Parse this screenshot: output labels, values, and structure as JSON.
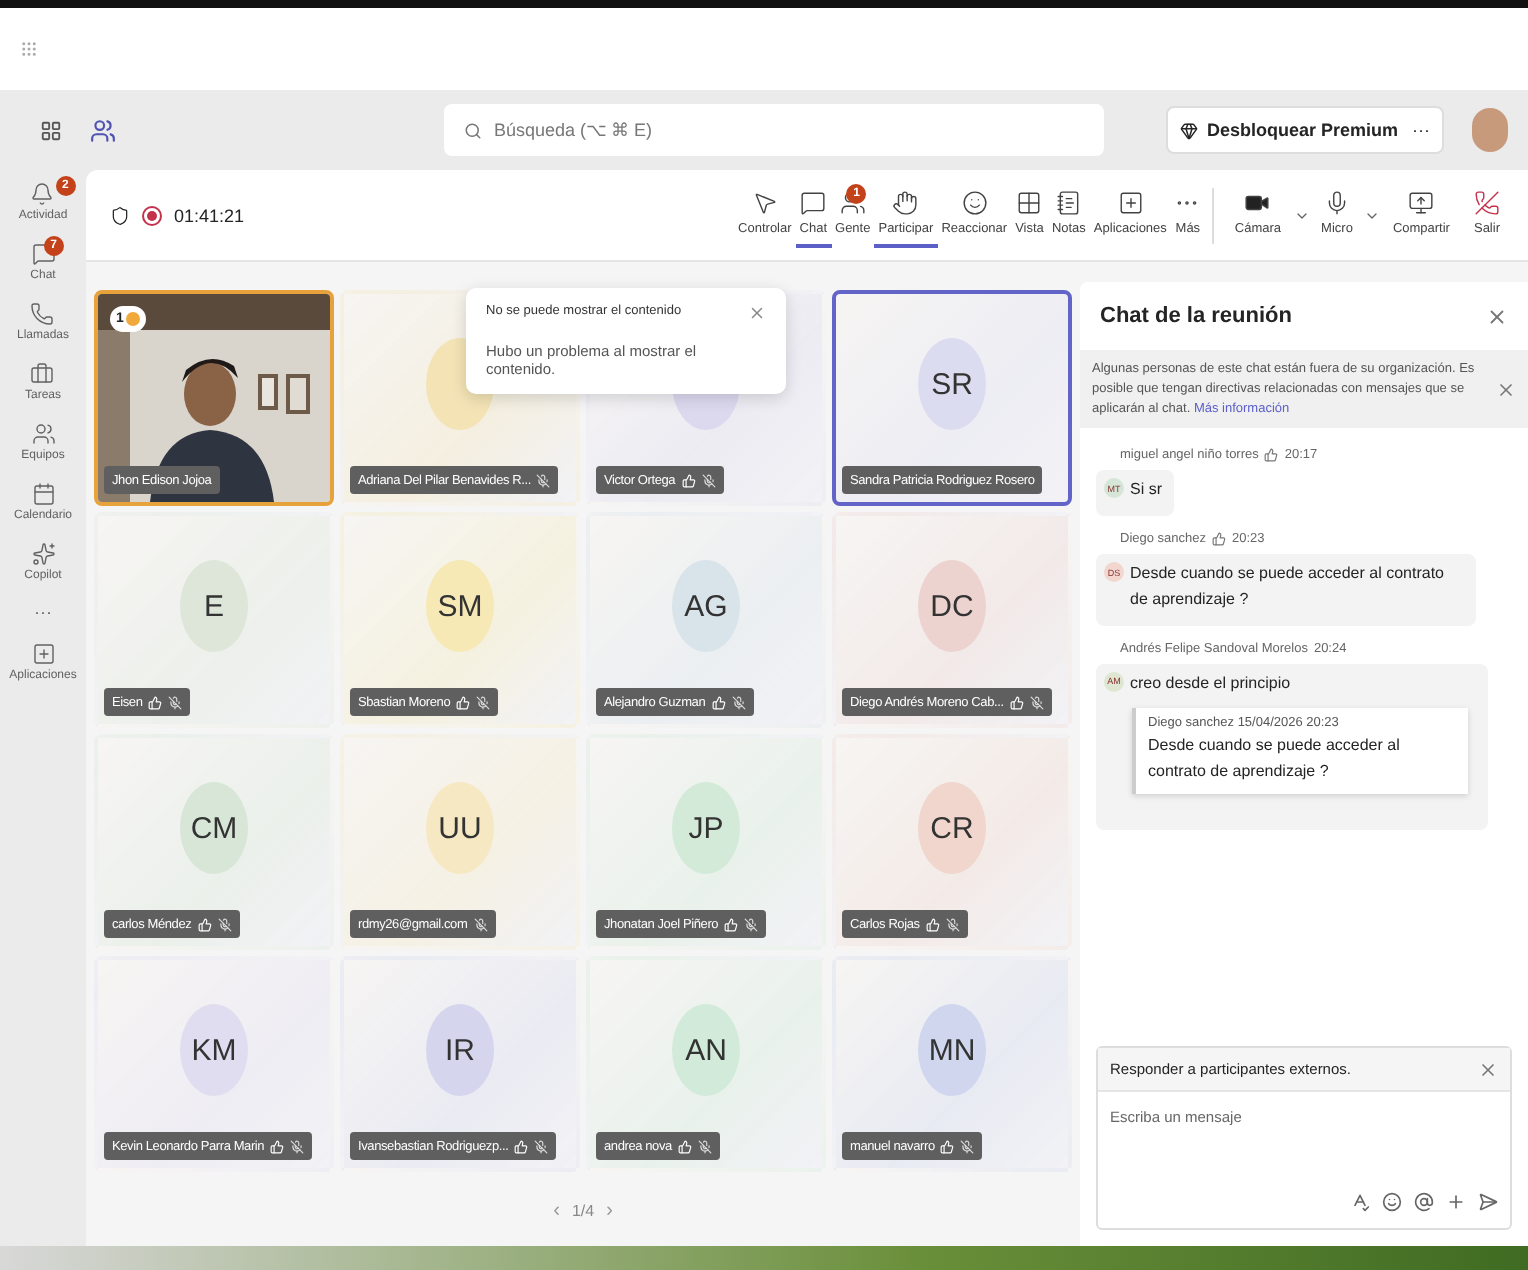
{
  "header": {
    "search": {
      "placeholder": "Búsqueda (⌥ ⌘ E)"
    },
    "premium_button": "Desbloquear Premium",
    "more": "···"
  },
  "rail": [
    {
      "label": "Actividad",
      "badge": "2"
    },
    {
      "label": "Chat",
      "badge": "7"
    },
    {
      "label": "Llamadas"
    },
    {
      "label": "Tareas"
    },
    {
      "label": "Equipos"
    },
    {
      "label": "Calendario"
    },
    {
      "label": "Copilot"
    },
    {
      "label": "···"
    },
    {
      "label": "Aplicaciones"
    }
  ],
  "meeting_bar": {
    "timer": "01:41:21",
    "recording": true,
    "tools": [
      {
        "label": "Controlar",
        "selected": false
      },
      {
        "label": "Chat",
        "selected": true
      },
      {
        "label": "Gente",
        "selected": false,
        "badge": "1"
      },
      {
        "label": "Participar",
        "selected": true
      },
      {
        "label": "Reaccionar",
        "selected": false
      },
      {
        "label": "Vista",
        "selected": false
      },
      {
        "label": "Notas",
        "selected": false
      },
      {
        "label": "Aplicaciones",
        "selected": false
      },
      {
        "label": "Más",
        "selected": false
      }
    ],
    "devices": [
      {
        "label": "Cámara",
        "chevron": true
      },
      {
        "label": "Micro",
        "chevron": true
      },
      {
        "label": "Compartir",
        "chevron": false
      },
      {
        "label": "Salir",
        "chevron": false
      }
    ]
  },
  "tiles": [
    {
      "kind": "video",
      "name": "Jhon Edison Jojoa",
      "hand_raised": true,
      "queue": "1",
      "speaking": false,
      "hand": false,
      "muted": false
    },
    {
      "kind": "avatar",
      "color": "#f3e3b5",
      "name": "Adriana Del Pilar Benavides R...",
      "hand_raised": false,
      "speaking": false,
      "hand": false,
      "muted": true
    },
    {
      "kind": "avatar",
      "color": "#dcd9ef",
      "name": "Victor Ortega",
      "hand_raised": false,
      "speaking": false,
      "hand": true,
      "muted": true
    },
    {
      "kind": "avatar",
      "initials": "SR",
      "color": "#dcdcf0",
      "name": "Sandra Patricia Rodriguez Rosero",
      "hand_raised": false,
      "speaking": true,
      "hand": false,
      "muted": false
    },
    {
      "kind": "avatar",
      "initials": "E",
      "color": "#dde6d8",
      "name": "Eisen",
      "hand_raised": false,
      "speaking": false,
      "hand": true,
      "muted": true
    },
    {
      "kind": "avatar",
      "initials": "SM",
      "color": "#f6e9b5",
      "name": "Sbastian Moreno",
      "hand_raised": false,
      "speaking": false,
      "hand": true,
      "muted": true
    },
    {
      "kind": "avatar",
      "initials": "AG",
      "color": "#d9e3ea",
      "name": "Alejandro Guzman",
      "hand_raised": false,
      "speaking": false,
      "hand": true,
      "muted": true
    },
    {
      "kind": "avatar",
      "initials": "DC",
      "color": "#ecd3cf",
      "name": "Diego Andrés Moreno Cab...",
      "hand_raised": false,
      "speaking": false,
      "hand": true,
      "muted": true
    },
    {
      "kind": "avatar",
      "initials": "CM",
      "color": "#d7e6d7",
      "name": "carlos Méndez",
      "hand_raised": false,
      "speaking": false,
      "hand": true,
      "muted": true
    },
    {
      "kind": "avatar",
      "initials": "UU",
      "color": "#f5e8c2",
      "name": "rdmy26@gmail.com",
      "hand_raised": false,
      "speaking": false,
      "hand": false,
      "muted": true
    },
    {
      "kind": "avatar",
      "initials": "JP",
      "color": "#d3ead8",
      "name": "Jhonatan Joel Piñero",
      "hand_raised": false,
      "speaking": false,
      "hand": true,
      "muted": true
    },
    {
      "kind": "avatar",
      "initials": "CR",
      "color": "#f0d6cc",
      "name": "Carlos Rojas",
      "hand_raised": false,
      "speaking": false,
      "hand": true,
      "muted": true
    },
    {
      "kind": "avatar",
      "initials": "KM",
      "color": "#e1ddf0",
      "name": "Kevin Leonardo Parra Marin",
      "hand_raised": false,
      "speaking": false,
      "hand": true,
      "muted": true
    },
    {
      "kind": "avatar",
      "initials": "IR",
      "color": "#d5d6ee",
      "name": "Ivansebastian Rodriguezp...",
      "hand_raised": false,
      "speaking": false,
      "hand": true,
      "muted": true
    },
    {
      "kind": "avatar",
      "initials": "AN",
      "color": "#d2ead9",
      "name": "andrea nova",
      "hand_raised": false,
      "speaking": false,
      "hand": true,
      "muted": true
    },
    {
      "kind": "avatar",
      "initials": "MN",
      "color": "#cfd6ee",
      "name": "manuel navarro",
      "hand_raised": false,
      "speaking": false,
      "hand": true,
      "muted": true
    }
  ],
  "notice": {
    "title": "No se puede mostrar el contenido",
    "body": "Hubo un problema al mostrar el contenido."
  },
  "pager": {
    "prev": "‹",
    "page": "1/4",
    "next": "›"
  },
  "chat": {
    "title": "Chat de la reunión",
    "banner": {
      "text": "Algunas personas de este chat están fuera de su organización. Es posible que tengan directivas relacionadas con mensajes que se aplicarán al chat.",
      "link": "Más información"
    },
    "messages": [
      {
        "author": "miguel angel niño torres",
        "hand": true,
        "time": "20:17",
        "initials": "MT",
        "color": "#d5e6d8",
        "text": "Si sr"
      },
      {
        "author": "Diego sanchez",
        "hand": true,
        "time": "20:23",
        "initials": "DS",
        "color": "#f2d6cf",
        "text": "Desde cuando se puede acceder al contrato de aprendizaje ?"
      },
      {
        "author": "Andrés Felipe Sandoval Morelos",
        "hand": false,
        "time": "20:24",
        "initials": "AM",
        "color": "#dfe6d2",
        "text": "creo desde el principio",
        "quote": {
          "author": "Diego sanchez",
          "time": "15/04/2026 20:23",
          "text": "Desde cuando se puede acceder al contrato de aprendizaje ?"
        }
      }
    ],
    "compose": {
      "reply_label": "Responder a participantes externos.",
      "placeholder": "Escriba un mensaje"
    }
  }
}
